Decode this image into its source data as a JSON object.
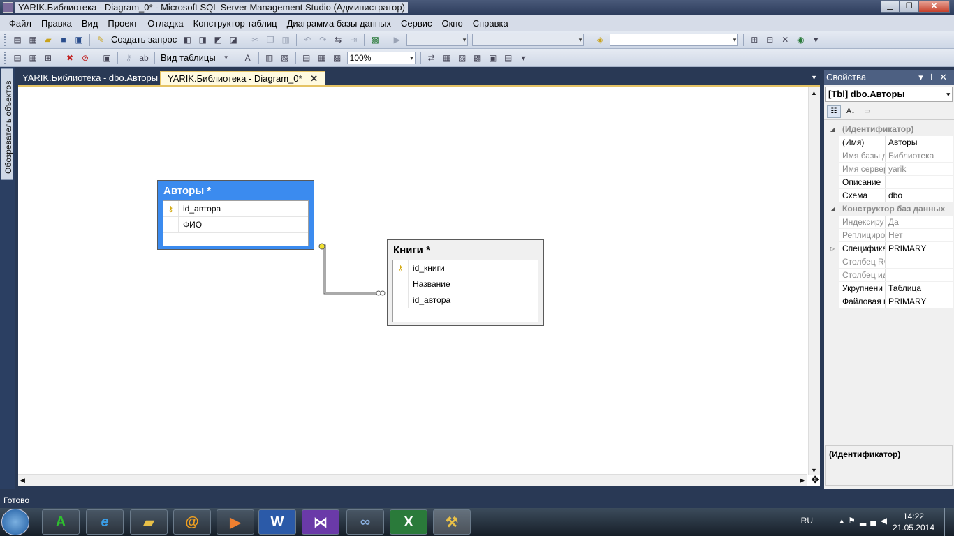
{
  "window": {
    "title": "YARIK.Библиотека - Diagram_0* - Microsoft SQL Server Management Studio (Администратор)",
    "buttons": [
      "▁",
      "❐",
      "✕"
    ]
  },
  "menu": [
    "Файл",
    "Правка",
    "Вид",
    "Проект",
    "Отладка",
    "Конструктор таблиц",
    "Диаграмма базы данных",
    "Сервис",
    "Окно",
    "Справка"
  ],
  "toolbar1": {
    "new_query_label": "Создать запрос"
  },
  "toolbar2": {
    "table_view_label": "Вид таблицы",
    "zoom_value": "100%"
  },
  "left_strip": {
    "object_explorer_label": "Обозреватель объектов"
  },
  "tabs": [
    {
      "label": "YARIK.Библиотека - dbo.Авторы",
      "active": false
    },
    {
      "label": "YARIK.Библиотека - Diagram_0*",
      "active": true
    }
  ],
  "diagram": {
    "authors": {
      "title": "Авторы *",
      "columns": [
        {
          "name": "id_автора",
          "key": true
        },
        {
          "name": "ФИО",
          "key": false
        }
      ]
    },
    "books": {
      "title": "Книги *",
      "columns": [
        {
          "name": "id_книги",
          "key": true
        },
        {
          "name": "Название",
          "key": false
        },
        {
          "name": "id_автора",
          "key": false
        }
      ]
    }
  },
  "properties": {
    "header": "Свойства",
    "object": "[Tbl] dbo.Авторы",
    "rows": [
      {
        "type": "cat",
        "name": "(Идентификатор)"
      },
      {
        "name": "(Имя)",
        "value": "Авторы"
      },
      {
        "name": "Имя базы д",
        "value": "Библиотека",
        "dim": true
      },
      {
        "name": "Имя сервер",
        "value": "yarik",
        "dim": true
      },
      {
        "name": "Описание",
        "value": ""
      },
      {
        "name": "Схема",
        "value": "dbo"
      },
      {
        "type": "cat",
        "name": "Конструктор баз данных"
      },
      {
        "name": "Индексиру",
        "value": "Да",
        "dim": true
      },
      {
        "name": "Реплициро",
        "value": "Нет",
        "dim": true
      },
      {
        "name": "Специфика",
        "value": "PRIMARY",
        "expand": true
      },
      {
        "name": "Столбец RO",
        "value": "",
        "dim": true
      },
      {
        "name": "Столбец ид",
        "value": "",
        "dim": true
      },
      {
        "name": "Укрупнени",
        "value": "Таблица"
      },
      {
        "name": "Файловая г",
        "value": "PRIMARY"
      }
    ],
    "description": "(Идентификатор)"
  },
  "status": "Готово",
  "taskbar": {
    "lang": "RU",
    "time": "14:22",
    "date": "21.05.2014"
  },
  "colors": {
    "accent": "#3b8bef",
    "tab_border": "#e5c365",
    "chrome": "#293955"
  }
}
